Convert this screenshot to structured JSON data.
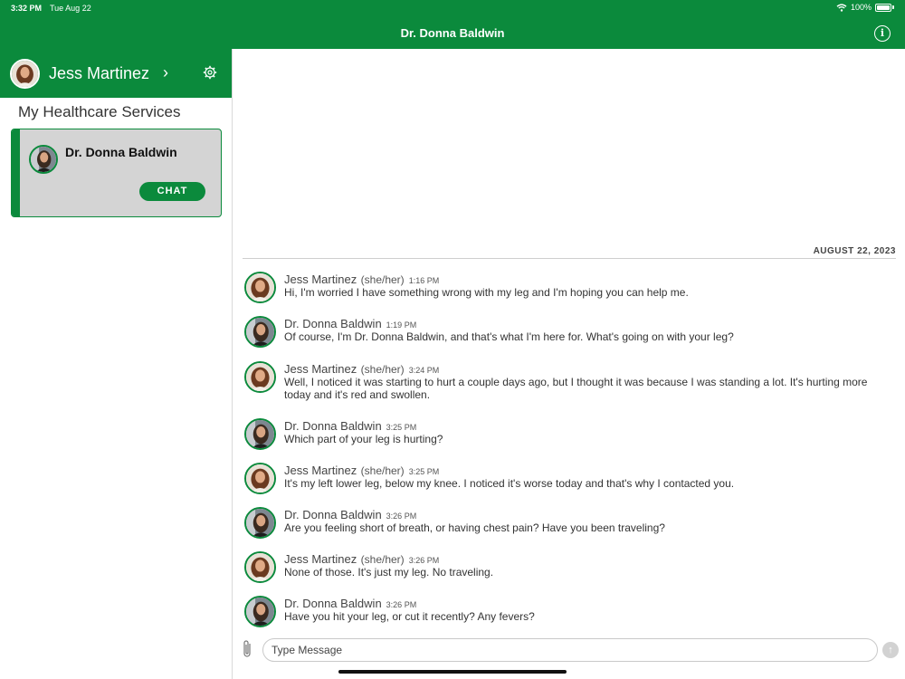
{
  "status_bar": {
    "time": "3:32 PM",
    "date": "Tue Aug 22",
    "battery": "100%"
  },
  "header": {
    "title": "Dr. Donna Baldwin",
    "info_icon": "info-icon"
  },
  "sidebar": {
    "profile_name": "Jess Martinez",
    "section_title": "My Healthcare Services",
    "services": [
      {
        "name": "Dr. Donna Baldwin",
        "action": "CHAT"
      }
    ]
  },
  "chat": {
    "date_label": "AUGUST 22, 2023",
    "messages": [
      {
        "author": "Jess Martinez",
        "pronouns": "(she/her)",
        "time": "1:16 PM",
        "text": "Hi, I'm worried I have something wrong with my leg and I'm hoping you can help me."
      },
      {
        "author": "Dr. Donna Baldwin",
        "pronouns": "",
        "time": "1:19 PM",
        "text": "Of course, I'm Dr. Donna Baldwin, and that's what I'm here for. What's going on with your leg?"
      },
      {
        "author": "Jess Martinez",
        "pronouns": "(she/her)",
        "time": "3:24 PM",
        "text": "Well, I noticed it was starting to hurt a couple days ago, but I thought it was because I was standing a lot. It's hurting more today and it's red and swollen."
      },
      {
        "author": "Dr. Donna Baldwin",
        "pronouns": "",
        "time": "3:25 PM",
        "text": "Which part of your leg is hurting?"
      },
      {
        "author": "Jess Martinez",
        "pronouns": "(she/her)",
        "time": "3:25 PM",
        "text": "It's my left lower leg, below my knee. I noticed it's worse today and that's why I contacted you."
      },
      {
        "author": "Dr. Donna Baldwin",
        "pronouns": "",
        "time": "3:26 PM",
        "text": "Are you feeling short of breath, or having chest pain? Have you been traveling?"
      },
      {
        "author": "Jess Martinez",
        "pronouns": "(she/her)",
        "time": "3:26 PM",
        "text": "None of those. It's just my leg. No traveling."
      },
      {
        "author": "Dr. Donna Baldwin",
        "pronouns": "",
        "time": "3:26 PM",
        "text": "Have you hit your leg, or cut it recently? Any fevers?"
      }
    ]
  },
  "composer": {
    "placeholder": "Type Message"
  },
  "colors": {
    "brand": "#0b8a3c",
    "card_bg": "#d4d4d4"
  }
}
